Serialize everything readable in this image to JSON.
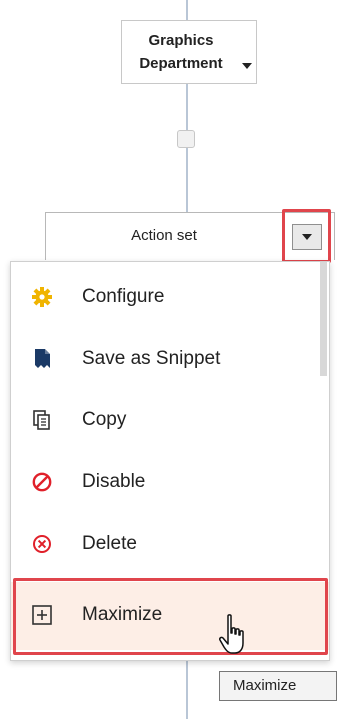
{
  "graph": {
    "top_node": {
      "title_line1": "Graphics",
      "title_line2": "Department"
    },
    "action_node": {
      "title": "Action set"
    }
  },
  "context_menu": {
    "items": [
      {
        "label": "Configure",
        "icon": "gear-icon"
      },
      {
        "label": "Save as Snippet",
        "icon": "snippet-file-icon"
      },
      {
        "label": "Copy",
        "icon": "copy-icon"
      },
      {
        "label": "Disable",
        "icon": "disable-icon"
      },
      {
        "label": "Delete",
        "icon": "delete-icon"
      },
      {
        "label": "Maximize",
        "icon": "maximize-icon"
      }
    ],
    "hovered_item": "Maximize"
  },
  "tooltip": {
    "text": "Maximize"
  },
  "colors": {
    "highlight_red": "#e0454c",
    "gear_yellow": "#f0b400",
    "snippet_blue": "#1b3a66",
    "disable_red": "#e0202a",
    "hover_bg": "#fdeee6",
    "connector": "#b9c6d6"
  }
}
